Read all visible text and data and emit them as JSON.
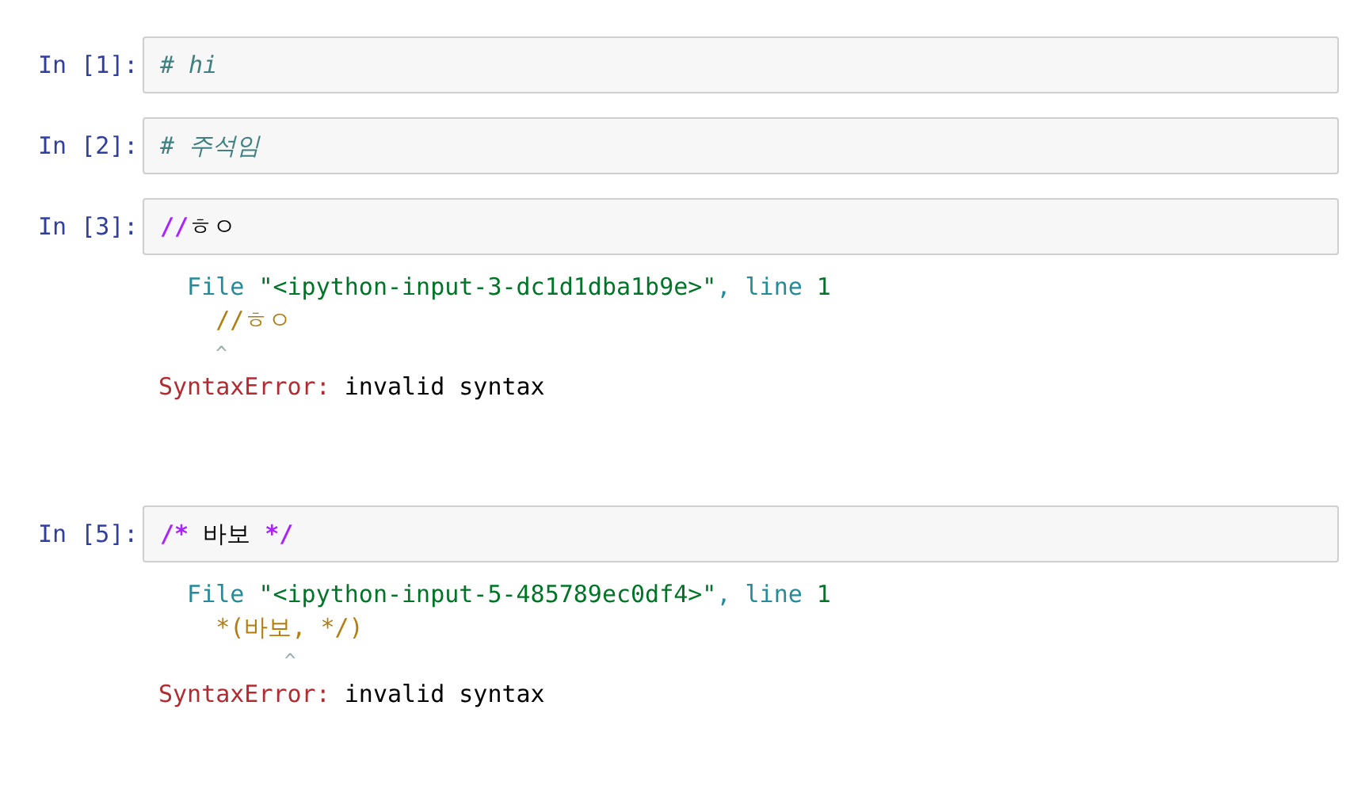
{
  "cells": [
    {
      "prompt": "In [1]:",
      "code": [
        {
          "text": "# hi",
          "kind": "comment"
        }
      ]
    },
    {
      "prompt": "In [2]:",
      "code": [
        {
          "text": "# 주석임",
          "kind": "comment"
        }
      ]
    },
    {
      "prompt": "In [3]:",
      "code": [
        {
          "text": "//",
          "kind": "operator"
        },
        {
          "text": "ㅎㅇ",
          "kind": "plain"
        }
      ],
      "output": {
        "lines": [
          [
            {
              "text": "  File ",
              "kind": "label"
            },
            {
              "text": "\"<ipython-input-3-dc1d1dba1b9e>\"",
              "kind": "string"
            },
            {
              "text": ", line ",
              "kind": "label"
            },
            {
              "text": "1",
              "kind": "string"
            }
          ],
          [
            {
              "text": "    //ㅎㅇ",
              "kind": "source"
            }
          ],
          [
            {
              "text": "     ^",
              "kind": "caret"
            }
          ]
        ],
        "error_name": "SyntaxError:",
        "error_message": " invalid syntax"
      }
    },
    {
      "prompt": "In [5]:",
      "code": [
        {
          "text": "/*",
          "kind": "operator"
        },
        {
          "text": " 바보 ",
          "kind": "plain"
        },
        {
          "text": "*/",
          "kind": "operator"
        }
      ],
      "output": {
        "lines": [
          [
            {
              "text": "  File ",
              "kind": "label"
            },
            {
              "text": "\"<ipython-input-5-485789ec0df4>\"",
              "kind": "string"
            },
            {
              "text": ", line ",
              "kind": "label"
            },
            {
              "text": "1",
              "kind": "string"
            }
          ],
          [
            {
              "text": "    *(바보, */)",
              "kind": "source"
            }
          ],
          [
            {
              "text": "           ^",
              "kind": "caret"
            }
          ]
        ],
        "error_name": "SyntaxError:",
        "error_message": " invalid syntax"
      }
    }
  ]
}
